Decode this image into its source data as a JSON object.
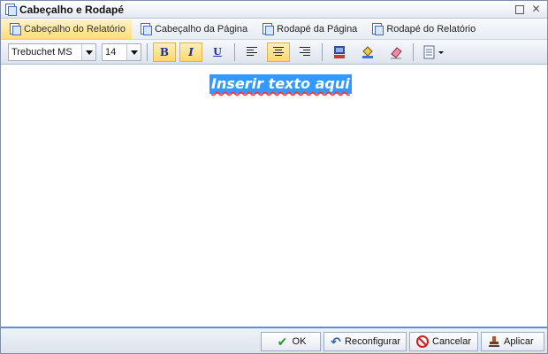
{
  "window": {
    "title": "Cabeçalho e Rodapé"
  },
  "tabs": [
    {
      "label": "Cabeçalho do Relatório",
      "active": true
    },
    {
      "label": "Cabeçalho da Página",
      "active": false
    },
    {
      "label": "Rodapé da Página",
      "active": false
    },
    {
      "label": "Rodapé do Relatório",
      "active": false
    }
  ],
  "toolbar": {
    "font_family": "Trebuchet MS",
    "font_size": "14",
    "bold_label": "B",
    "italic_label": "I",
    "underline_label": "U"
  },
  "editor": {
    "text": "Inserir texto aqui"
  },
  "footer": {
    "ok_label": "OK",
    "reset_label": "Reconfigurar",
    "cancel_label": "Cancelar",
    "apply_label": "Aplicar"
  },
  "colors": {
    "accent": "#5b8fd8",
    "selection": "#3399ff",
    "active_tab": "#ffdc7a"
  }
}
